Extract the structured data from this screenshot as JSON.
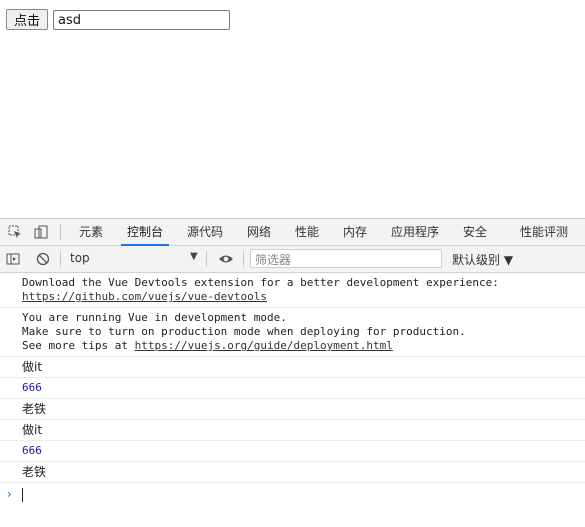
{
  "page": {
    "button_label": "点击",
    "input_value": "asd"
  },
  "devtools": {
    "tabs": [
      "元素",
      "控制台",
      "源代码",
      "网络",
      "性能",
      "内存",
      "应用程序",
      "安全",
      "性能评测"
    ],
    "active_tab": "控制台",
    "context_select": "top",
    "filter_placeholder": "筛选器",
    "levels_label": "默认级别 ▼"
  },
  "console": {
    "messages": [
      {
        "line1": "Download the Vue Devtools extension for a better development experience:",
        "link": "https://github.com/vuejs/vue-devtools"
      },
      {
        "line1": "You are running Vue in development mode.",
        "line2": "Make sure to turn on production mode when deploying for production.",
        "line3_prefix": "See more tips at ",
        "link": "https://vuejs.org/guide/deployment.html"
      }
    ],
    "logs": [
      "做it",
      "666",
      "老铁",
      "做it",
      "666",
      "老铁"
    ]
  },
  "colors": {
    "accent": "#1a73e8",
    "number": "#1a1aa6"
  }
}
